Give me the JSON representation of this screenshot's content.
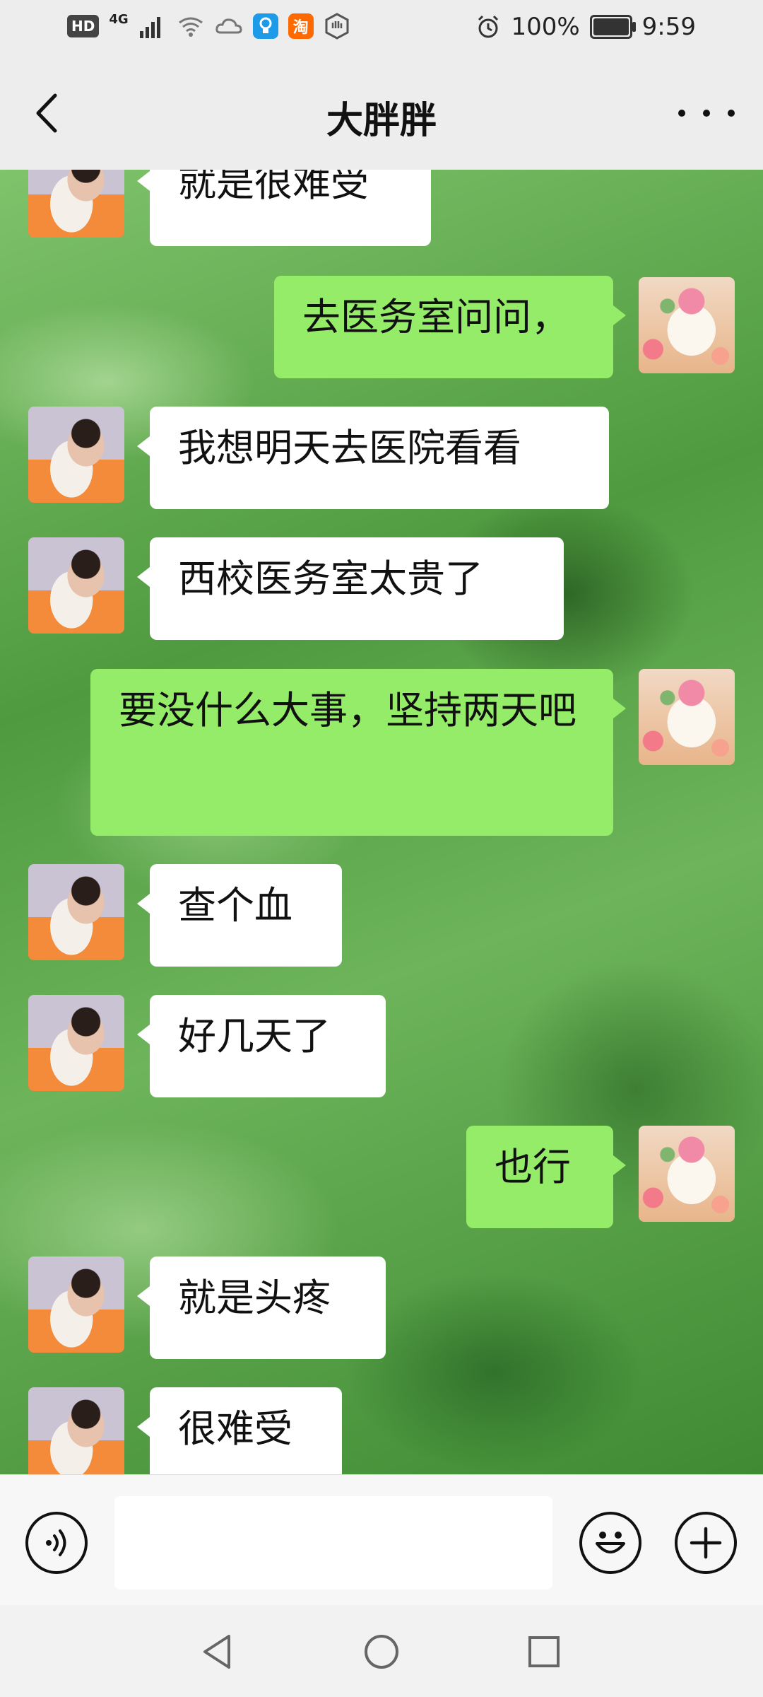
{
  "status_bar": {
    "left_badges": [
      "HD",
      "4G"
    ],
    "app_icons": [
      {
        "name": "tips-icon",
        "color": "#1e9be8",
        "glyph": "♀"
      },
      {
        "name": "taobao-icon",
        "color": "#ff6a00",
        "glyph": "淘"
      }
    ],
    "battery_text": "100%",
    "battery_level": 1.0,
    "time": "9:59"
  },
  "header": {
    "title": "大胖胖"
  },
  "messages": [
    {
      "side": "in",
      "text": "就是很难受"
    },
    {
      "side": "out",
      "text": "去医务室问问，"
    },
    {
      "side": "in",
      "text": "我想明天去医院看看"
    },
    {
      "side": "in",
      "text": "西校医务室太贵了"
    },
    {
      "side": "out",
      "text": "要没什么大事，坚持两天吧"
    },
    {
      "side": "in",
      "text": "查个血"
    },
    {
      "side": "in",
      "text": "好几天了"
    },
    {
      "side": "out",
      "text": "也行"
    },
    {
      "side": "in",
      "text": "就是头疼"
    },
    {
      "side": "in",
      "text": "很难受"
    }
  ],
  "input_bar": {
    "value": "",
    "icons": [
      "voice-icon",
      "emoji-icon",
      "plus-icon"
    ]
  },
  "nav_bar": {
    "icons": [
      "back-nav-icon",
      "home-nav-icon",
      "recents-nav-icon"
    ]
  },
  "colors": {
    "incoming_bubble": "#ffffff",
    "outgoing_bubble": "#95ec69",
    "bar_background": "#ededed"
  }
}
